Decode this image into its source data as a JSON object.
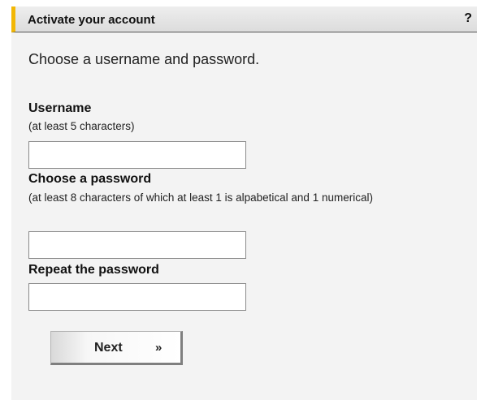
{
  "header": {
    "title": "Activate your account",
    "help_label": "?"
  },
  "intro": "Choose a username and password.",
  "fields": {
    "username": {
      "label": "Username",
      "hint": "(at least 5 characters)",
      "value": ""
    },
    "password": {
      "label": "Choose a password",
      "hint": "(at least 8 characters of which at least 1 is alpabetical and 1 numerical)",
      "value": ""
    },
    "repeat_password": {
      "label": "Repeat the password",
      "value": ""
    }
  },
  "next_button": {
    "label": "Next",
    "icon": "double-chevron-right-icon",
    "glyph": "»"
  },
  "colors": {
    "accent": "#f2b705",
    "header_bg": "#dcdcdc",
    "panel_bg": "#f3f3f3"
  }
}
